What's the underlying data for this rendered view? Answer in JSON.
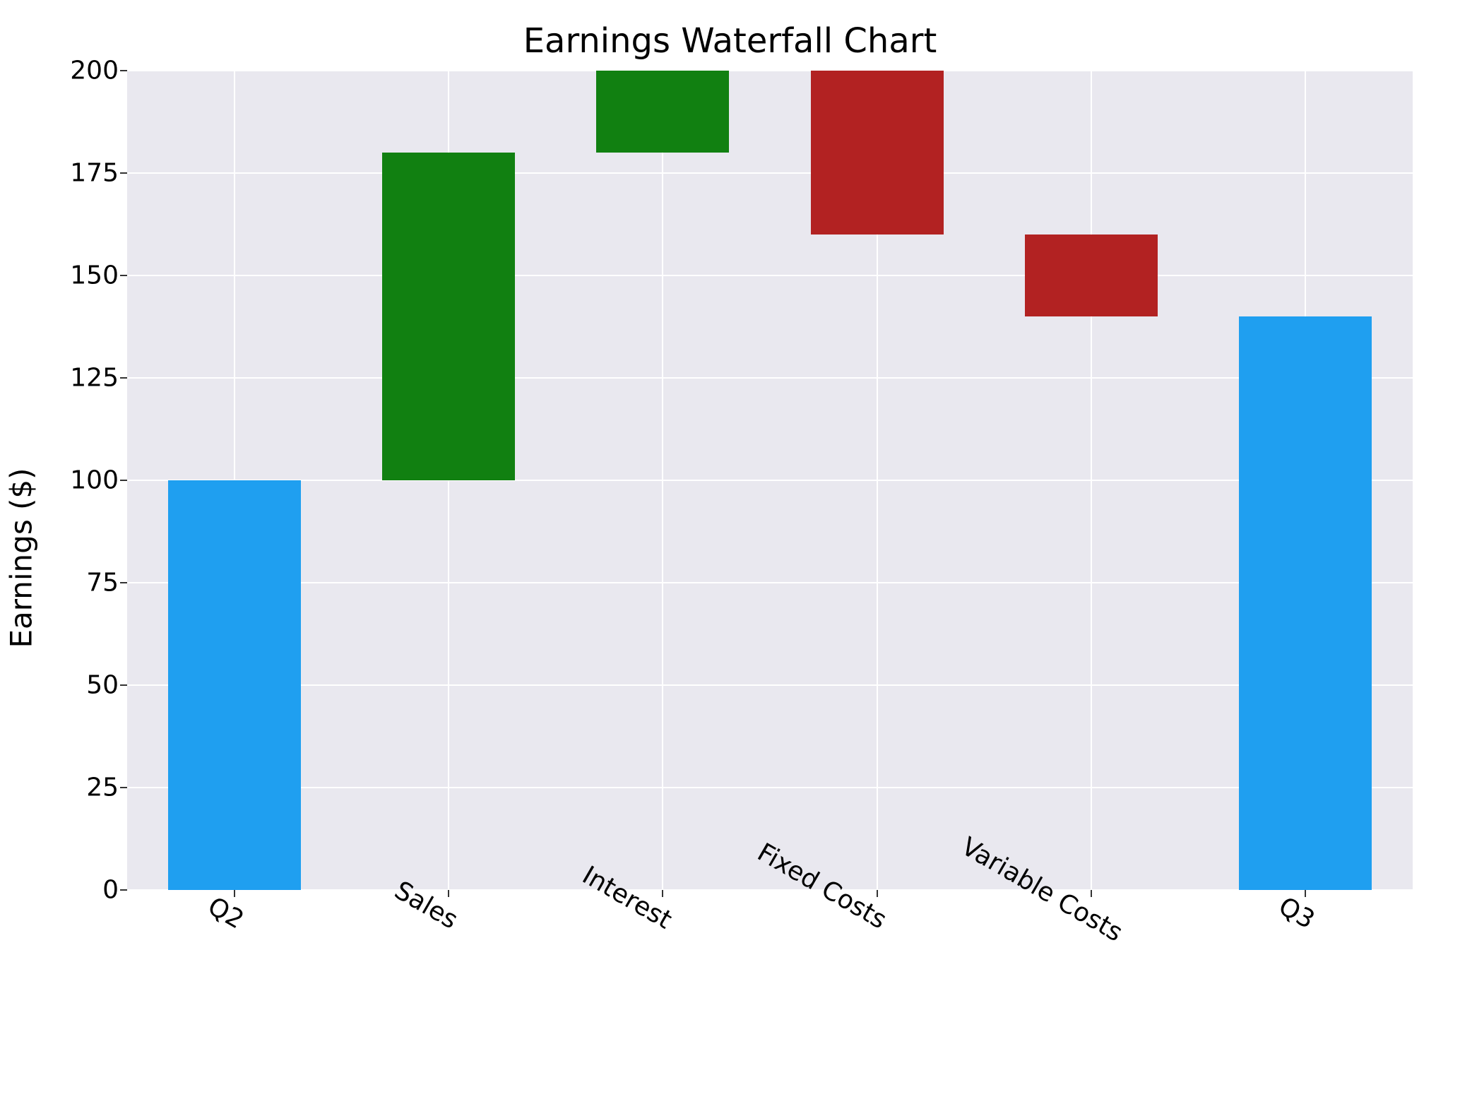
{
  "chart_data": {
    "type": "bar",
    "title": "Earnings Waterfall Chart",
    "ylabel": "Earnings ($)",
    "xlabel": "",
    "ylim": [
      0,
      200
    ],
    "yticks": [
      0,
      25,
      50,
      75,
      100,
      125,
      150,
      175,
      200
    ],
    "categories": [
      "Q2",
      "Sales",
      "Interest",
      "Fixed Costs",
      "Variable Costs",
      "Q3"
    ],
    "bars": [
      {
        "label": "Q2",
        "bottom": 0,
        "top": 100,
        "kind": "total",
        "color": "#1f9ff0"
      },
      {
        "label": "Sales",
        "bottom": 100,
        "top": 180,
        "kind": "increase",
        "color": "#118011"
      },
      {
        "label": "Interest",
        "bottom": 180,
        "top": 200,
        "kind": "increase",
        "color": "#118011"
      },
      {
        "label": "Fixed Costs",
        "bottom": 160,
        "top": 200,
        "kind": "decrease",
        "color": "#b22222"
      },
      {
        "label": "Variable Costs",
        "bottom": 140,
        "top": 160,
        "kind": "decrease",
        "color": "#b22222"
      },
      {
        "label": "Q3",
        "bottom": 0,
        "top": 140,
        "kind": "total",
        "color": "#1f9ff0"
      }
    ]
  }
}
